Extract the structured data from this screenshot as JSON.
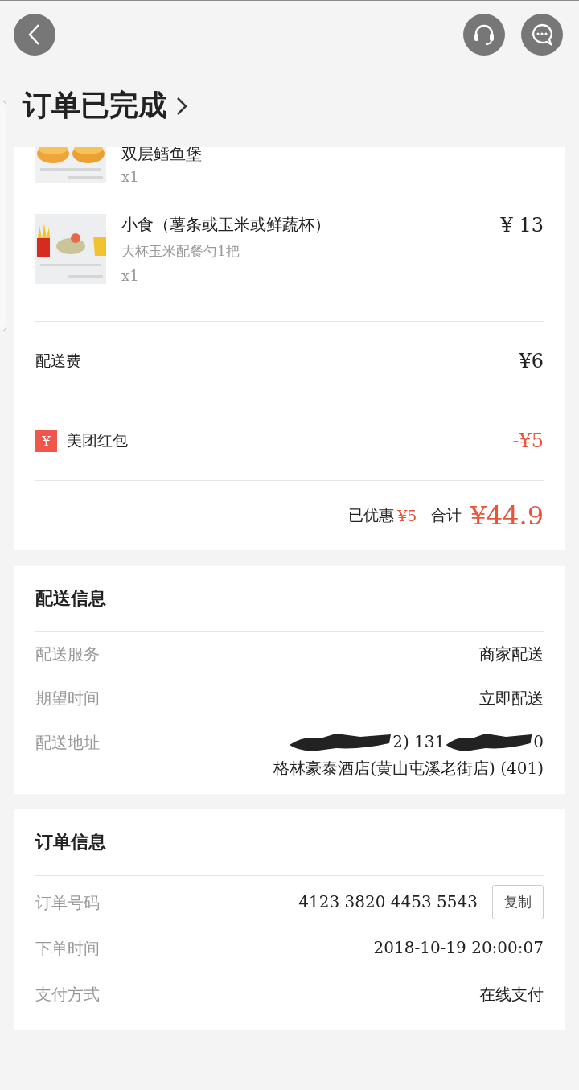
{
  "status": {
    "title": "订单已完成"
  },
  "order_items": [
    {
      "name": "双层鳕鱼堡",
      "quantity": "x1"
    },
    {
      "name": "小食（薯条或玉米或鲜蔬杯）",
      "note": "大杯玉米配餐勺1把",
      "quantity": "x1",
      "price": "¥ 13"
    }
  ],
  "fees": [
    {
      "kind": "fee",
      "label": "配送费",
      "amount": "¥6"
    },
    {
      "kind": "discount",
      "badge": "¥",
      "label": "美团红包",
      "amount": "-¥5"
    }
  ],
  "summary": {
    "discount_label": "已优惠",
    "discount_amount": "¥5",
    "total_label": "合计",
    "total_amount": "¥44.9"
  },
  "delivery": {
    "title": "配送信息",
    "rows": [
      {
        "kind": "plain",
        "label": "配送服务",
        "value": "商家配送"
      },
      {
        "kind": "plain",
        "label": "期望时间",
        "value": "立即配送"
      },
      {
        "kind": "address",
        "label": "配送地址",
        "contact_parts": [
          "2) 131",
          "0"
        ],
        "address": "格林豪泰酒店(黄山屯溪老街店) (401)"
      }
    ]
  },
  "order": {
    "title": "订单信息",
    "rows": [
      {
        "kind": "plain",
        "label": "订单号码",
        "value": "4123 3820 4453 5543",
        "action": "复制"
      },
      {
        "kind": "plain",
        "label": "下单时间",
        "value": "2018-10-19 20:00:07"
      },
      {
        "kind": "plain",
        "label": "支付方式",
        "value": "在线支付"
      }
    ]
  }
}
